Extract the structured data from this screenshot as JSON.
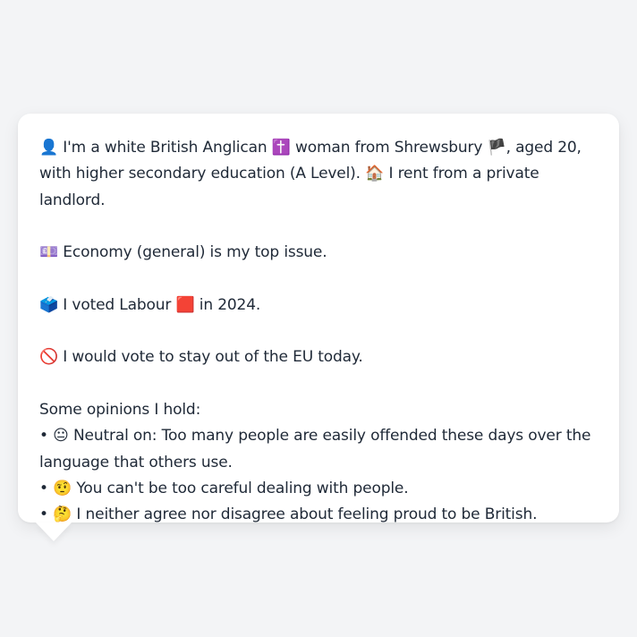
{
  "bubble": {
    "profile": {
      "icon1": "👤",
      "text1": " I'm a white British Anglican ",
      "icon2": "✝️",
      "text2": " woman from Shrewsbury ",
      "icon3": "🏴",
      "text3": ", aged 20, with higher secondary education (A Level). ",
      "icon4": "🏠",
      "text4": " I rent from a private landlord."
    },
    "issue": {
      "icon": "💷",
      "text": " Economy (general) is my top issue."
    },
    "vote": {
      "icon1": "🗳️",
      "text1": " I voted Labour ",
      "icon2": "🟥",
      "text2": " in 2024."
    },
    "eu": {
      "icon": "🚫",
      "text": " I would vote to stay out of the EU today."
    },
    "opinions": {
      "heading": "Some opinions I hold:",
      "items": [
        {
          "bullet": "• ",
          "icon": "😐",
          "text": " Neutral on: Too many people are easily offended these days over the language that others use."
        },
        {
          "bullet": "• ",
          "icon": "🤨",
          "text": " You can't be too careful dealing with people."
        },
        {
          "bullet": "• ",
          "icon": "🤔",
          "text": " I neither agree nor disagree about feeling proud to be British."
        }
      ]
    }
  }
}
